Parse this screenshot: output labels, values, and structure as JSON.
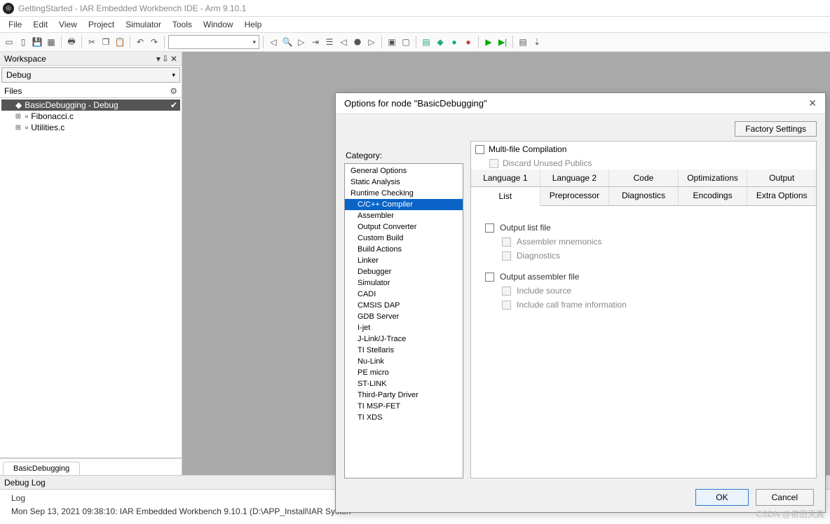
{
  "title": "GettingStarted - IAR Embedded Workbench IDE - Arm 9.10.1",
  "menu": [
    "File",
    "Edit",
    "View",
    "Project",
    "Simulator",
    "Tools",
    "Window",
    "Help"
  ],
  "workspace": {
    "panel_title": "Workspace",
    "config": "Debug",
    "files_label": "Files",
    "project_row": "BasicDebugging - Debug",
    "children": [
      "Fibonacci.c",
      "Utilities.c"
    ],
    "tab": "BasicDebugging"
  },
  "debuglog": {
    "header": "Debug Log",
    "col": "Log",
    "line1": "Mon Sep 13, 2021 09:38:10: IAR Embedded Workbench 9.10.1 (D:\\APP_Install\\IAR Systen"
  },
  "dialog": {
    "title": "Options for node \"BasicDebugging\"",
    "category_label": "Category:",
    "factory": "Factory Settings",
    "categories": [
      {
        "t": "General Options",
        "i": 0
      },
      {
        "t": "Static Analysis",
        "i": 0
      },
      {
        "t": "Runtime Checking",
        "i": 0
      },
      {
        "t": "C/C++ Compiler",
        "i": 1,
        "sel": true
      },
      {
        "t": "Assembler",
        "i": 1
      },
      {
        "t": "Output Converter",
        "i": 1
      },
      {
        "t": "Custom Build",
        "i": 1
      },
      {
        "t": "Build Actions",
        "i": 1
      },
      {
        "t": "Linker",
        "i": 1
      },
      {
        "t": "Debugger",
        "i": 1
      },
      {
        "t": "Simulator",
        "i": 2
      },
      {
        "t": "CADI",
        "i": 2
      },
      {
        "t": "CMSIS DAP",
        "i": 2
      },
      {
        "t": "GDB Server",
        "i": 2
      },
      {
        "t": "I-jet",
        "i": 2
      },
      {
        "t": "J-Link/J-Trace",
        "i": 2
      },
      {
        "t": "TI Stellaris",
        "i": 2
      },
      {
        "t": "Nu-Link",
        "i": 2
      },
      {
        "t": "PE micro",
        "i": 2
      },
      {
        "t": "ST-LINK",
        "i": 2
      },
      {
        "t": "Third-Party Driver",
        "i": 2
      },
      {
        "t": "TI MSP-FET",
        "i": 2
      },
      {
        "t": "TI XDS",
        "i": 2
      }
    ],
    "mfc": "Multi-file Compilation",
    "mfc_sub": "Discard Unused Publics",
    "tabs_row1": [
      "Language 1",
      "Language 2",
      "Code",
      "Optimizations",
      "Output"
    ],
    "tabs_row2": [
      "List",
      "Preprocessor",
      "Diagnostics",
      "Encodings",
      "Extra Options"
    ],
    "active_tab": "List",
    "opts": {
      "out_list": "Output list file",
      "asm_mn": "Assembler mnemonics",
      "diag": "Diagnostics",
      "out_asm": "Output assembler file",
      "inc_src": "Include source",
      "inc_cfi": "Include call frame information"
    },
    "ok": "OK",
    "cancel": "Cancel"
  },
  "watermark": "CSDN @依旧天真"
}
